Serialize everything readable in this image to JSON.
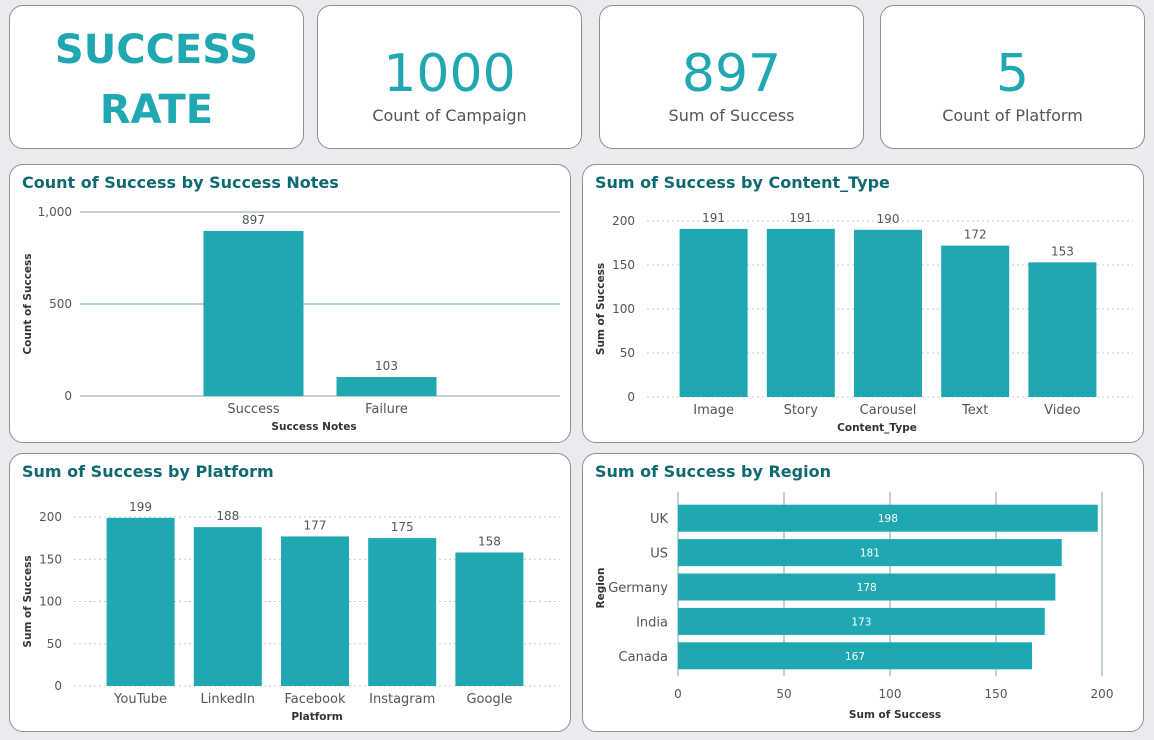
{
  "kpis": {
    "title_line1": "SUCCESS",
    "title_line2": "RATE",
    "campaign_value": "1000",
    "campaign_label": "Count of Campaign",
    "success_value": "897",
    "success_label": "Sum of Success",
    "platform_value": "5",
    "platform_label": "Count of Platform"
  },
  "colors": {
    "accent": "#1fa7b2",
    "title": "#0e6a70"
  },
  "chart_data": [
    {
      "type": "bar",
      "title": "Count of Success by Success Notes",
      "xlabel": "Success Notes",
      "ylabel": "Count of Success",
      "categories": [
        "Success",
        "Failure"
      ],
      "values": [
        897,
        103
      ],
      "ylim": [
        0,
        1000
      ],
      "yticks": [
        "0",
        "500",
        "1,000"
      ],
      "grid": true
    },
    {
      "type": "bar",
      "title": "Sum of Success by Content_Type",
      "xlabel": "Content_Type",
      "ylabel": "Sum of Success",
      "categories": [
        "Image",
        "Story",
        "Carousel",
        "Text",
        "Video"
      ],
      "values": [
        191,
        191,
        190,
        172,
        153
      ],
      "ylim": [
        0,
        200
      ],
      "yticks": [
        "0",
        "50",
        "100",
        "150",
        "200"
      ],
      "grid": true
    },
    {
      "type": "bar",
      "title": "Sum of Success by Platform",
      "xlabel": "Platform",
      "ylabel": "Sum of Success",
      "categories": [
        "YouTube",
        "LinkedIn",
        "Facebook",
        "Instagram",
        "Google"
      ],
      "values": [
        199,
        188,
        177,
        175,
        158
      ],
      "ylim": [
        0,
        200
      ],
      "yticks": [
        "0",
        "50",
        "100",
        "150",
        "200"
      ],
      "grid": true
    },
    {
      "type": "bar",
      "orientation": "horizontal",
      "title": "Sum of Success by Region",
      "xlabel": "Sum of Success",
      "ylabel": "Region",
      "categories": [
        "UK",
        "US",
        "Germany",
        "India",
        "Canada"
      ],
      "values": [
        198,
        181,
        178,
        173,
        167
      ],
      "xlim": [
        0,
        200
      ],
      "xticks": [
        "0",
        "50",
        "100",
        "150",
        "200"
      ],
      "grid": true
    }
  ]
}
